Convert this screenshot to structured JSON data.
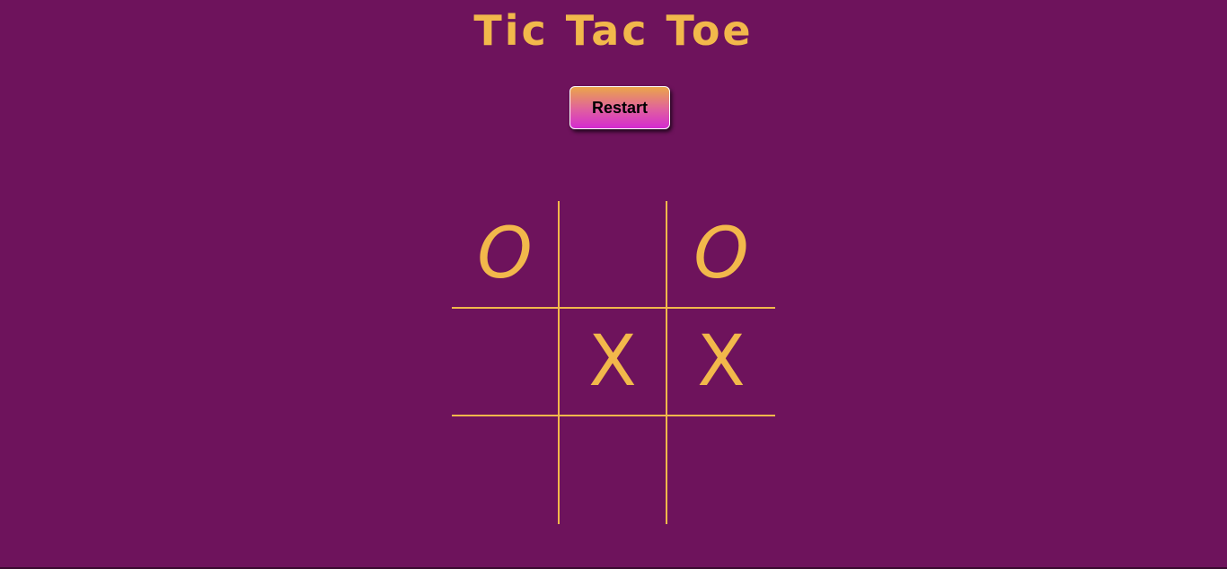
{
  "page": {
    "title": "Tic Tac Toe"
  },
  "controls": {
    "restart_label": "Restart"
  },
  "board": {
    "cells": [
      "O",
      "",
      "O",
      "",
      "X",
      "X",
      "",
      "",
      ""
    ]
  },
  "colors": {
    "background": "#6e135c",
    "accent": "#f2b84b",
    "button_gradient_top": "#eba54a",
    "button_gradient_bottom": "#d42bd0"
  }
}
